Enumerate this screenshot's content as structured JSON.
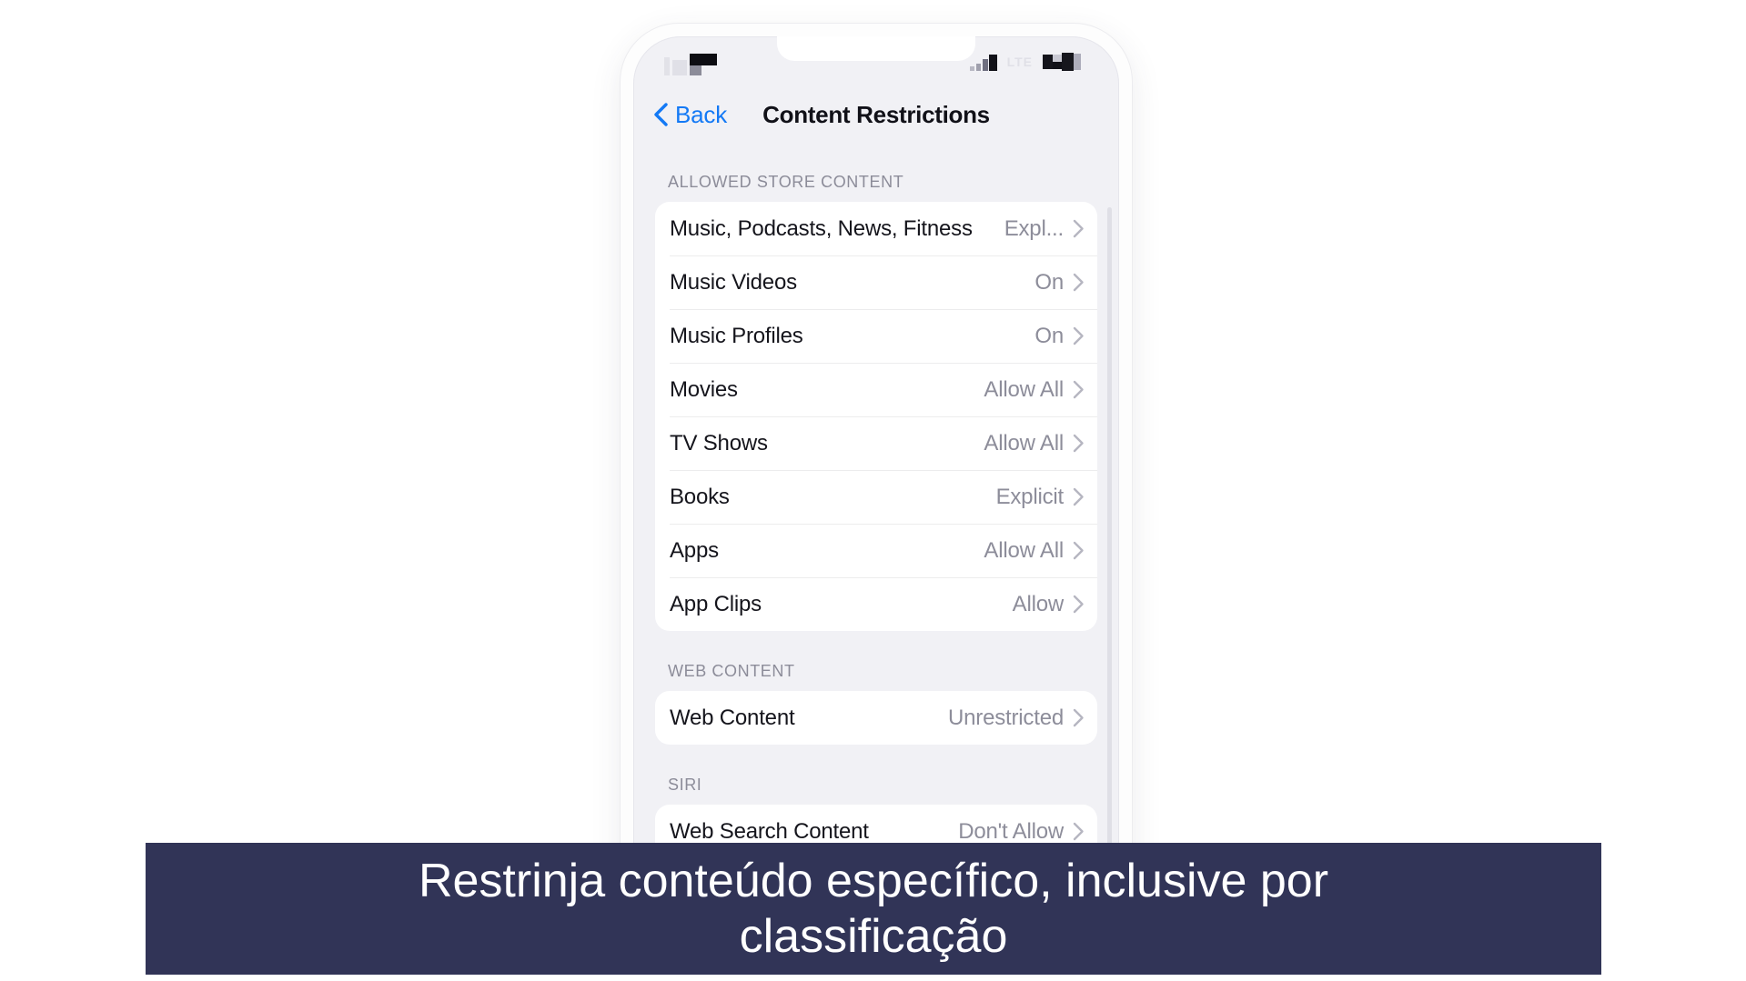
{
  "device": {
    "status_bar": {
      "time_redacted": true,
      "carrier_label": "LTE",
      "signal_icon": "cellular-signal-icon",
      "battery_icon": "battery-icon"
    },
    "nav": {
      "back_label": "Back",
      "back_icon": "chevron-left-icon",
      "title": "Content Restrictions"
    }
  },
  "sections": [
    {
      "header": "ALLOWED STORE CONTENT",
      "rows": [
        {
          "label": "Music, Podcasts, News, Fitness",
          "value": "Expl...",
          "chevron": "chevron-right-icon"
        },
        {
          "label": "Music Videos",
          "value": "On",
          "chevron": "chevron-right-icon"
        },
        {
          "label": "Music Profiles",
          "value": "On",
          "chevron": "chevron-right-icon"
        },
        {
          "label": "Movies",
          "value": "Allow All",
          "chevron": "chevron-right-icon"
        },
        {
          "label": "TV Shows",
          "value": "Allow All",
          "chevron": "chevron-right-icon"
        },
        {
          "label": "Books",
          "value": "Explicit",
          "chevron": "chevron-right-icon"
        },
        {
          "label": "Apps",
          "value": "Allow All",
          "chevron": "chevron-right-icon"
        },
        {
          "label": "App Clips",
          "value": "Allow",
          "chevron": "chevron-right-icon"
        }
      ]
    },
    {
      "header": "WEB CONTENT",
      "rows": [
        {
          "label": "Web Content",
          "value": "Unrestricted",
          "chevron": "chevron-right-icon"
        }
      ]
    },
    {
      "header": "SIRI",
      "rows": [
        {
          "label": "Web Search Content",
          "value": "Don't Allow",
          "chevron": "chevron-right-icon"
        }
      ]
    }
  ],
  "caption": {
    "line1": "Restrinja conteúdo específico, inclusive por",
    "line2": "classificação",
    "background": "#313457",
    "text_color": "#ffffff"
  },
  "colors": {
    "accent_blue": "#1379f5",
    "screen_background": "#f1f1f5",
    "card_background": "#ffffff",
    "secondary_text": "#8d8d9a",
    "primary_text": "#15151c"
  }
}
